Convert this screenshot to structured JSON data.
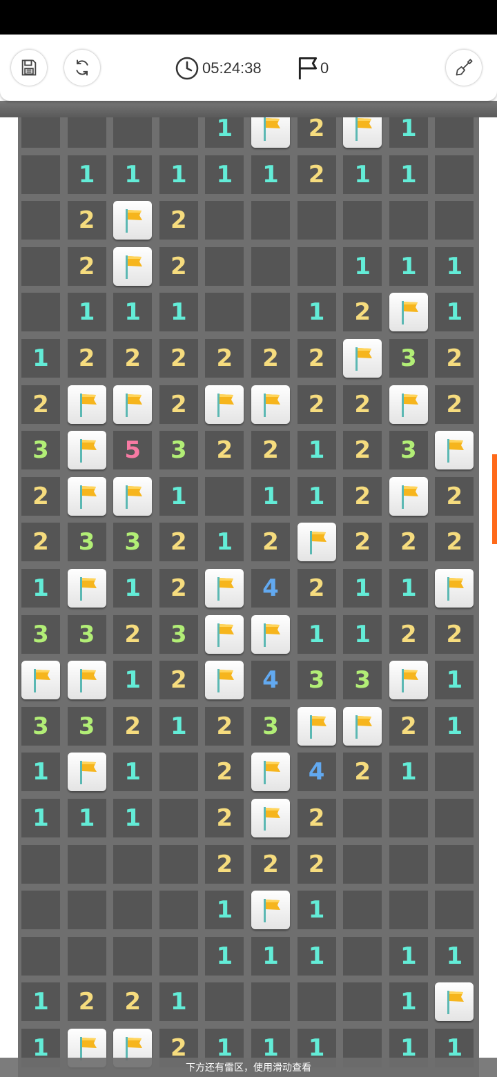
{
  "toolbar": {
    "save_icon": "save-icon",
    "restart_icon": "restart-icon",
    "timer_icon": "clock-icon",
    "timer_value": "05:24:38",
    "flag_icon": "flag-icon",
    "flag_count": "0",
    "shovel_icon": "shovel-icon"
  },
  "board": {
    "columns": 10,
    "legend": "'.' = opened empty cell, 'F' = flagged cell, digit = adjacent mine count",
    "rows": [
      ". . . . 1 F 2 F 1 .",
      ". 1 1 1 1 1 2 1 1 .",
      ". 2 F 2 . . . . . .",
      ". 2 F 2 . . . 1 1 1",
      ". 1 1 1 . . 1 2 F 1",
      "1 2 2 2 2 2 2 F 3 2",
      "2 F F 2 F F 2 2 F 2",
      "3 F 5 3 2 2 1 2 3 F",
      "2 F F 1 . 1 1 2 F 2",
      "2 3 3 2 1 2 F 2 2 2",
      "1 F 1 2 F 4 2 1 1 F",
      "3 3 2 3 F F 1 1 2 2",
      "F F 1 2 F 4 3 3 F 1",
      "3 3 2 1 2 3 F F 2 1",
      "1 F 1 . 2 F 4 2 1 .",
      "1 1 1 . 2 F 2 . . .",
      ". . . . 2 2 2 . . .",
      ". . . . 1 F 1 . . .",
      ". . . . 1 1 1 . 1 1",
      "1 2 2 1 . . . . 1 F",
      "1 F F 2 1 1 1 . 1 1"
    ],
    "number_colors": {
      "1": "#63ecd7",
      "2": "#f6dc7e",
      "3": "#b2ee76",
      "4": "#62a9f0",
      "5": "#f77aa3"
    },
    "flag_color": "#f6b51d"
  },
  "hint": "下方还有雷区，使用滑动查看",
  "accent_color": "#ff6a1a"
}
